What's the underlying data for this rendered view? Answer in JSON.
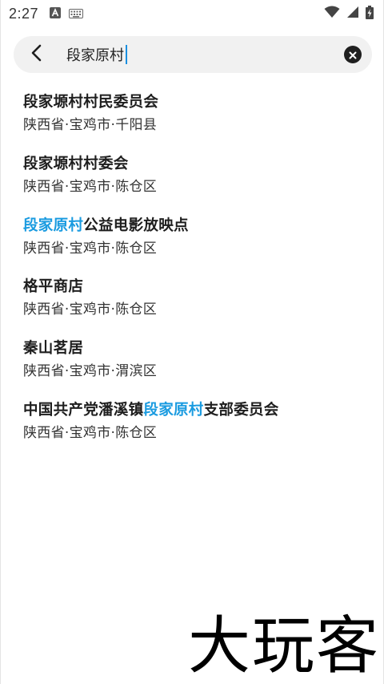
{
  "status_bar": {
    "time": "2:27",
    "icons": [
      "a-notification-icon",
      "keyboard-icon",
      "wifi-icon",
      "signal-icon",
      "battery-charging-icon"
    ]
  },
  "search": {
    "query": "段家原村"
  },
  "results": [
    {
      "title_pre": "段家塬村村民委员会",
      "title_hl": "",
      "title_post": "",
      "subtitle": "陕西省·宝鸡市·千阳县"
    },
    {
      "title_pre": "段家塬村村委会",
      "title_hl": "",
      "title_post": "",
      "subtitle": "陕西省·宝鸡市·陈仓区"
    },
    {
      "title_pre": "",
      "title_hl": "段家原村",
      "title_post": "公益电影放映点",
      "subtitle": "陕西省·宝鸡市·陈仓区"
    },
    {
      "title_pre": "格平商店",
      "title_hl": "",
      "title_post": "",
      "subtitle": "陕西省·宝鸡市·陈仓区"
    },
    {
      "title_pre": "秦山茗居",
      "title_hl": "",
      "title_post": "",
      "subtitle": "陕西省·宝鸡市·渭滨区"
    },
    {
      "title_pre": "中国共产党潘溪镇",
      "title_hl": "段家原村",
      "title_post": "支部委员会",
      "subtitle": "陕西省·宝鸡市·陈仓区"
    }
  ],
  "watermark": "大玩客",
  "colors": {
    "highlight": "#1a9be0",
    "search_bg": "#f1f1f1"
  }
}
